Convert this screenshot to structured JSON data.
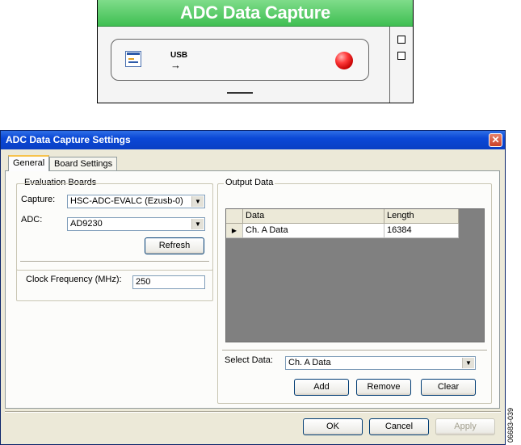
{
  "snippet": {
    "title": "ADC Data Capture",
    "usb_label": "USB",
    "usb_arrow": "→",
    "status_led_color": "#e52020"
  },
  "dialog": {
    "title": "ADC Data Capture Settings",
    "close_glyph": "✕",
    "tabs": [
      {
        "label": "General",
        "active": true
      },
      {
        "label": "Board Settings",
        "active": false
      }
    ],
    "evaluation_boards": {
      "legend": "Evaluation Boards",
      "capture_label": "Capture:",
      "capture_value": "HSC-ADC-EVALC (Ezusb-0)",
      "adc_label": "ADC:",
      "adc_value": "AD9230",
      "refresh_label": "Refresh",
      "clock_label": "Clock Frequency (MHz):",
      "clock_value": "250"
    },
    "output_data": {
      "legend": "Output Data",
      "columns": [
        "Data",
        "Length"
      ],
      "rows": [
        {
          "marker": "▶",
          "data": "Ch. A Data",
          "length": "16384"
        }
      ],
      "select_label": "Select Data:",
      "select_value": "Ch. A Data",
      "add_label": "Add",
      "remove_label": "Remove",
      "clear_label": "Clear"
    },
    "footer": {
      "ok_label": "OK",
      "cancel_label": "Cancel",
      "apply_label": "Apply"
    }
  },
  "figure_id": "06683-039"
}
